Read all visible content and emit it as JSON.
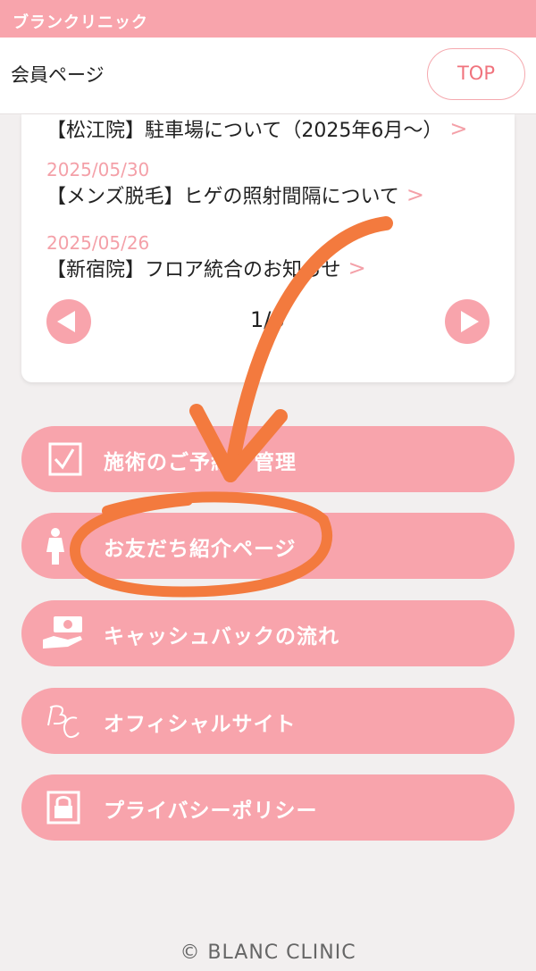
{
  "brand": {
    "name": "ブランクリニック"
  },
  "header": {
    "title": "会員ページ",
    "top_button": "TOP"
  },
  "news": {
    "items": [
      {
        "date": "",
        "title": "【松江院】駐車場について（2025年6月〜）",
        "chevron": ">"
      },
      {
        "date": "2025/05/30",
        "title": "【メンズ脱毛】ヒゲの照射間隔について",
        "chevron": ">"
      },
      {
        "date": "2025/05/26",
        "title": "【新宿院】フロア統合のお知らせ",
        "chevron": ">"
      }
    ],
    "page_indicator": "1/6"
  },
  "menu": {
    "items": [
      {
        "label": "施術のご予約・管理",
        "icon": "checkbox-icon"
      },
      {
        "label": "お友だち紹介ページ",
        "icon": "woman-icon"
      },
      {
        "label": "キャッシュバックの流れ",
        "icon": "cash-hand-icon"
      },
      {
        "label": "オフィシャルサイト",
        "icon": "bc-logo-icon"
      },
      {
        "label": "プライバシーポリシー",
        "icon": "lock-icon"
      }
    ]
  },
  "footer": {
    "copyright": "© BLANC CLINIC"
  },
  "colors": {
    "brand_pink": "#f8a4ac",
    "accent": "#f0737d",
    "annotation_orange": "#f37a3e"
  }
}
